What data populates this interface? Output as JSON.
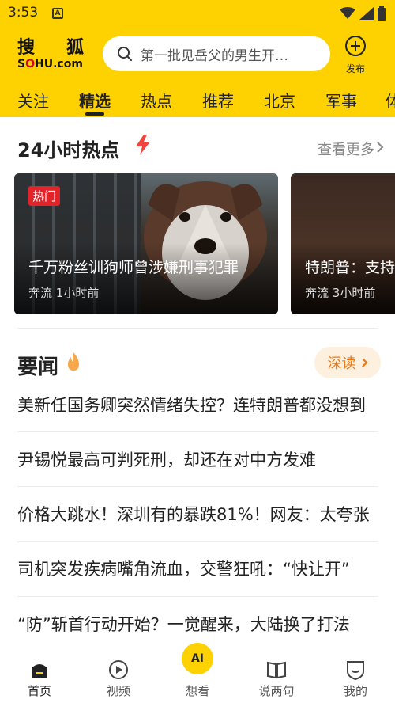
{
  "status_bar": {
    "time": "3:53",
    "notification_icon_letter": "A"
  },
  "header": {
    "logo_cn": [
      "搜",
      "狐"
    ],
    "logo_en": {
      "before": "S",
      "u": "O",
      "after": "HU.com"
    },
    "search": {
      "placeholder": "第一批见岳父的男生开…"
    },
    "publish_label": "发布",
    "background": "#fed100"
  },
  "tabs": [
    "关注",
    "精选",
    "热点",
    "推荐",
    "北京",
    "军事",
    "体"
  ],
  "active_tab": "精选",
  "hot_section": {
    "title": "24小时热点",
    "see_more": "查看更多",
    "cards": [
      {
        "badge": "热门",
        "title": "千万粉丝训狗师曾涉嫌刑事犯罪",
        "source": "奔流",
        "time": "1小时前"
      },
      {
        "title": "特朗普：支持",
        "source": "奔流",
        "time": "3小时前"
      }
    ]
  },
  "news_section": {
    "title": "要闻",
    "deep_read": "深读",
    "items": [
      "美新任国务卿突然情绪失控？连特朗普都没想到",
      "尹锡悦最高可判死刑，却还在对中方发难",
      "价格大跳水！深圳有的暴跌81%！网友：太夸张",
      "司机突发疾病嘴角流血，交警狂吼：“快让开”",
      "“防”斩首行动开始？一觉醒来，大陆换了打法"
    ]
  },
  "bottom_nav": {
    "items": [
      {
        "label": "首页",
        "icon": "home-icon",
        "active": true
      },
      {
        "label": "视频",
        "icon": "play-icon",
        "active": false
      },
      {
        "label": "想看",
        "icon": "ai-icon",
        "ai_text": "AI",
        "active": false
      },
      {
        "label": "说两句",
        "icon": "comment-book-icon",
        "active": false
      },
      {
        "label": "我的",
        "icon": "profile-badge-icon",
        "active": false
      }
    ]
  },
  "colors": {
    "accent_yellow": "#fed100",
    "hot_badge_red": "#e2232a",
    "deep_read_orange": "#e97a1a",
    "bolt_red": "#f0453c"
  }
}
